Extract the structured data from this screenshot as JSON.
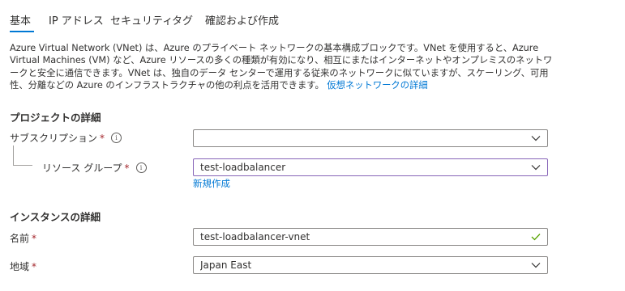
{
  "tabs": [
    "基本",
    "IP アドレス",
    "セキュリティ",
    "タグ",
    "確認および作成"
  ],
  "description": {
    "text": "Azure Virtual Network (VNet) は、Azure のプライベート ネットワークの基本構成ブロックです。VNet を使用すると、Azure Virtual Machines (VM) など、Azure リソースの多くの種類が有効になり、相互にまたはインターネットやオンプレミスのネットワークと安全に通信できます。VNet は、独自のデータ センターで運用する従来のネットワークに似ていますが、スケーリング、可用性、分離などの Azure のインフラストラクチャの他の利点を活用できます。",
    "link": "仮想ネットワークの詳細"
  },
  "project": {
    "title": "プロジェクトの詳細",
    "subscription_label": "サブスクリプション",
    "subscription_value": "",
    "resource_group_label": "リソース グループ",
    "resource_group_value": "test-loadbalancer",
    "create_new_link": "新規作成"
  },
  "instance": {
    "title": "インスタンスの詳細",
    "name_label": "名前",
    "name_value": "test-loadbalancer-vnet",
    "region_label": "地域",
    "region_value": "Japan East"
  },
  "required_mark": "*",
  "info_glyph": "i",
  "colors": {
    "accent": "#0078d4",
    "required": "#a4262c",
    "valid_check": "#57a300",
    "focus_border": "#8764b8"
  }
}
